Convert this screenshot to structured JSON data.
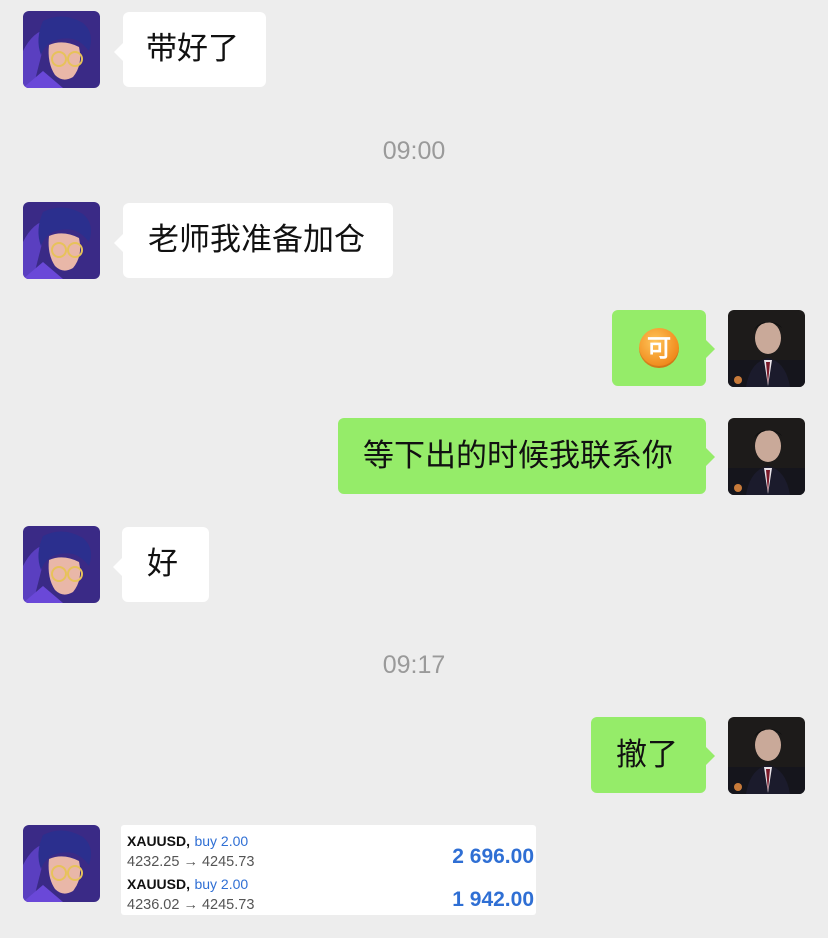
{
  "messages": [
    {
      "text": "带好了"
    },
    {
      "text": "老师我准备加仓"
    },
    {
      "text": "可"
    },
    {
      "text": "等下出的时候我联系你"
    },
    {
      "text": "好"
    },
    {
      "text": "撤了"
    }
  ],
  "timestamps": [
    "09:00",
    "09:17"
  ],
  "trade_card": {
    "rows": [
      {
        "symbol": "XAUUSD,",
        "action": "buy 2.00",
        "prices": "4232.25 → 4245.73",
        "profit": "2 696.00"
      },
      {
        "symbol": "XAUUSD,",
        "action": "buy 2.00",
        "prices": "4236.02 → 4245.73",
        "profit": "1 942.00"
      }
    ]
  },
  "colors": {
    "background": "#ededed",
    "incoming_bubble": "#ffffff",
    "outgoing_bubble": "#95ec69",
    "profit_blue": "#2f6fd4"
  },
  "icons": {
    "sticker": "ke-emoji-icon"
  }
}
